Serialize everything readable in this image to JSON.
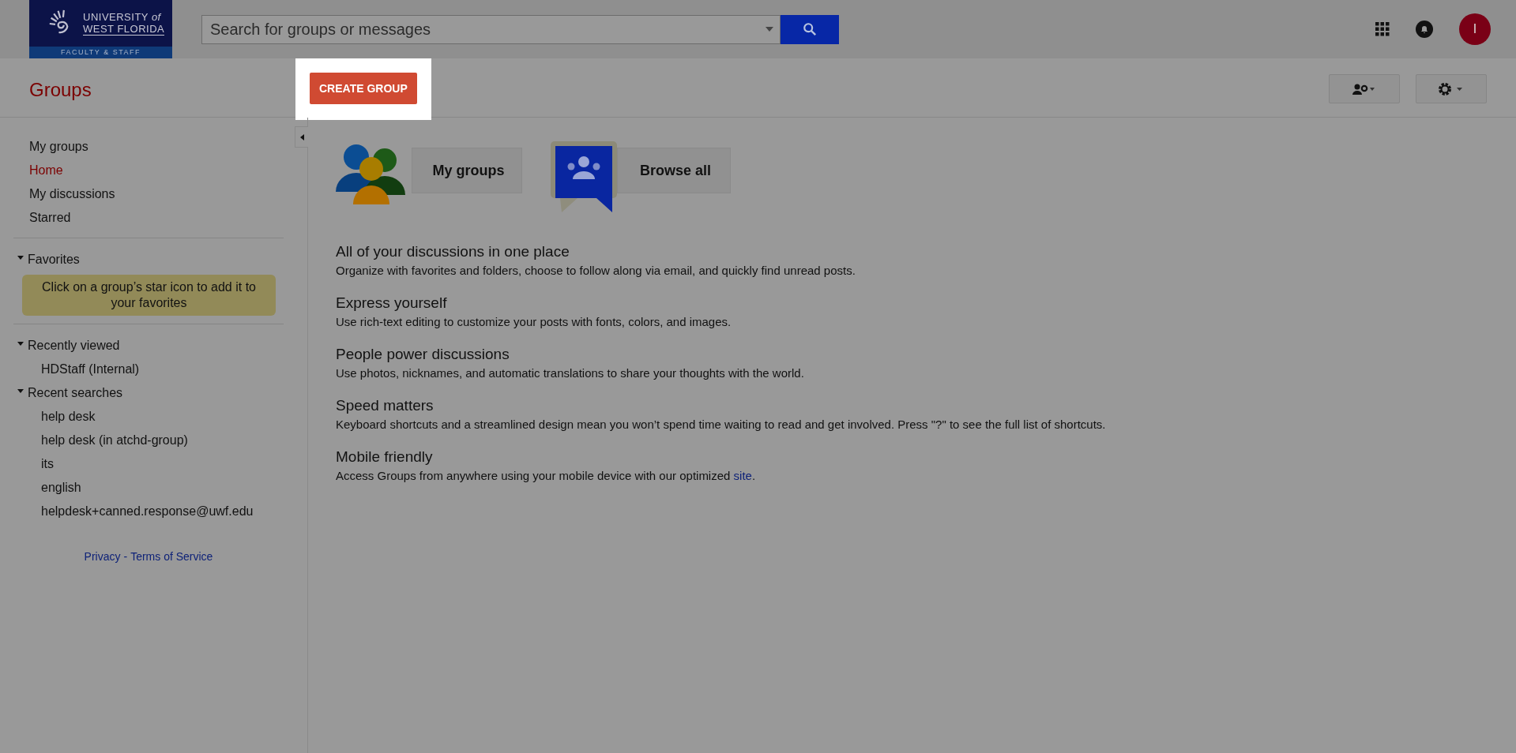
{
  "header": {
    "logo": {
      "line1": "UNIVERSITY",
      "line1_suffix": "of",
      "line2": "WEST FLORIDA",
      "subtitle": "FACULTY & STAFF"
    },
    "search": {
      "placeholder": "Search for groups or messages"
    },
    "avatar": {
      "letter": "I"
    }
  },
  "toolbar": {
    "title": "Groups",
    "create_button": "CREATE GROUP"
  },
  "sidebar": {
    "nav": [
      {
        "label": "My groups",
        "selected": false
      },
      {
        "label": "Home",
        "selected": true
      },
      {
        "label": "My discussions",
        "selected": false
      },
      {
        "label": "Starred",
        "selected": false
      }
    ],
    "sections": [
      {
        "title": "Favorites",
        "expanded": true,
        "note": "Click on a group’s star icon to add it to your favorites"
      },
      {
        "title": "Recently viewed",
        "expanded": true,
        "items": [
          "HDStaff (Internal)"
        ]
      },
      {
        "title": "Recent searches",
        "expanded": true,
        "items": [
          "help desk",
          "help desk (in atchd-group)",
          "its",
          "english",
          "helpdesk+canned.response@uwf.edu"
        ]
      }
    ],
    "footer": {
      "privacy": "Privacy",
      "separator": "-",
      "terms": "Terms of Service"
    }
  },
  "main": {
    "tiles": [
      {
        "kind": "people",
        "label": "My groups"
      },
      {
        "kind": "browse",
        "label": "Browse all"
      }
    ],
    "features": [
      {
        "title": "All of your discussions in one place",
        "text": "Organize with favorites and folders, choose to follow along via email, and quickly find unread posts."
      },
      {
        "title": "Express yourself",
        "text": "Use rich-text editing to customize your posts with fonts, colors, and images."
      },
      {
        "title": "People power discussions",
        "text": "Use photos, nicknames, and automatic translations to share your thoughts with the world."
      },
      {
        "title": "Speed matters",
        "text": "Keyboard shortcuts and a streamlined design mean you won’t spend time waiting to read and get involved. Press \"?\" to see the full list of shortcuts."
      },
      {
        "title": "Mobile friendly",
        "text": "Access Groups from anywhere using your mobile device with our optimized",
        "link": "site",
        "after": "."
      }
    ]
  }
}
